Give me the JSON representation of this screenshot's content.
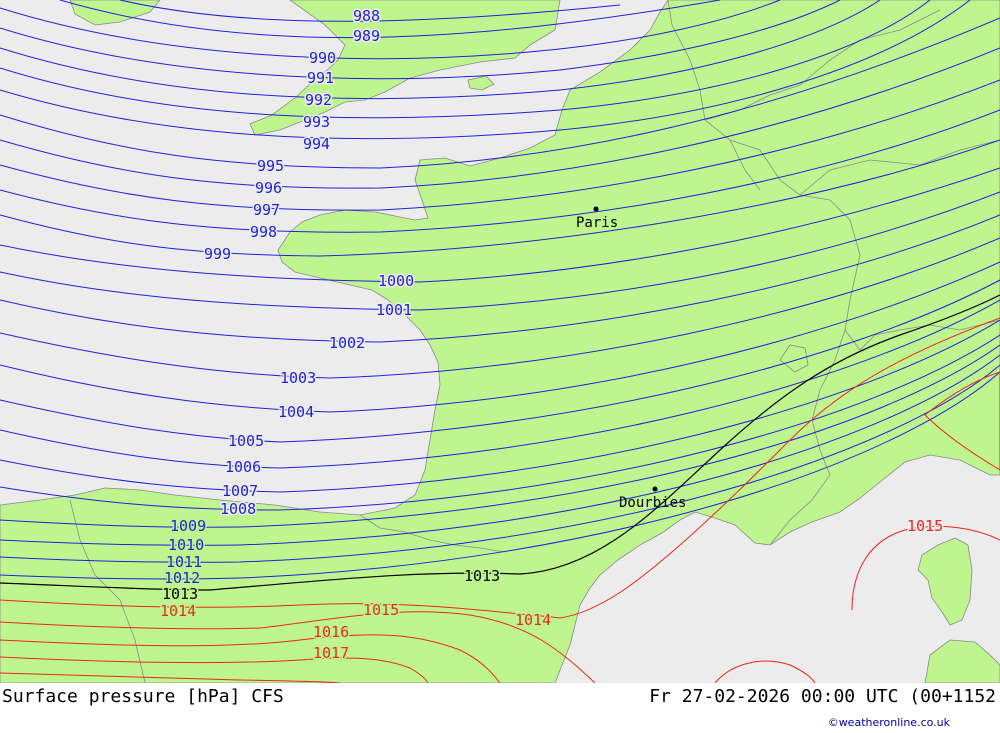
{
  "map": {
    "title": "Surface pressure [hPa] CFS",
    "valid_time": "Fr 27-02-2026 00:00 UTC (00+1152",
    "credit": "©weatheronline.co.uk",
    "colors": {
      "sea": "#ececec",
      "land": "#bff58f",
      "isobar_low": "#1f1fd6",
      "isobar_ref": "#000000",
      "isobar_high": "#e8281e"
    },
    "cities": [
      {
        "name": "Paris"
      },
      {
        "name": "Dourbies"
      }
    ],
    "isobar_labels": {
      "988": "988",
      "989": "989",
      "990": "990",
      "991": "991",
      "992": "992",
      "993": "993",
      "994": "994",
      "995": "995",
      "996": "996",
      "997": "997",
      "998": "998",
      "999": "999",
      "1000": "1000",
      "1001": "1001",
      "1002": "1002",
      "1003": "1003",
      "1004": "1004",
      "1005": "1005",
      "1006": "1006",
      "1007": "1007",
      "1008": "1008",
      "1009": "1009",
      "1010": "1010",
      "1011": "1011",
      "1012": "1012",
      "1013": "1013",
      "1014": "1014",
      "1015": "1015",
      "1016": "1016",
      "1017": "1017"
    }
  }
}
